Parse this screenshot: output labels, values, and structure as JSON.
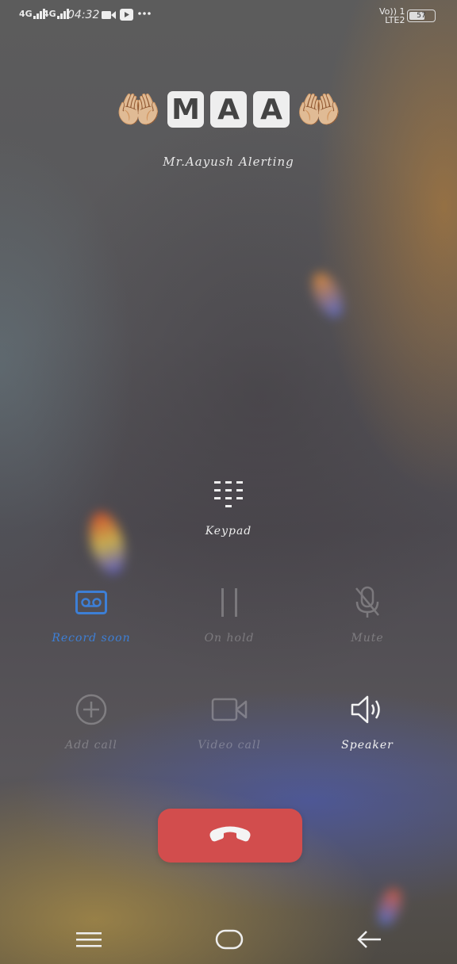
{
  "status_bar": {
    "sim1_network": "4G",
    "sim2_network": "4G",
    "time": "04:32",
    "notification_icons": [
      "video-camera-icon",
      "youtube-icon",
      "more-dots-icon"
    ],
    "volte_label": "Vo)) 1",
    "lte_label": "LTE2",
    "battery_percent": "57"
  },
  "contact": {
    "name_letters": [
      "M",
      "A",
      "A"
    ],
    "emoji": "🤲🏼",
    "subtitle": "Mr.Aayush  Alerting"
  },
  "keypad": {
    "label": "Keypad"
  },
  "controls": [
    {
      "id": "record",
      "label": "Record soon",
      "icon": "record-tape-icon",
      "state": "active",
      "color": "#3d7fd6"
    },
    {
      "id": "hold",
      "label": "On hold",
      "icon": "pause-icon",
      "state": "disabled"
    },
    {
      "id": "mute",
      "label": "Mute",
      "icon": "microphone-off-icon",
      "state": "disabled"
    },
    {
      "id": "add_call",
      "label": "Add call",
      "icon": "plus-circle-icon",
      "state": "disabled"
    },
    {
      "id": "video_call",
      "label": "Video call",
      "icon": "video-camera-icon",
      "state": "disabled"
    },
    {
      "id": "speaker",
      "label": "Speaker",
      "icon": "speaker-icon",
      "state": "enabled"
    }
  ],
  "end_call": {
    "icon": "end-call-icon",
    "color": "#d24d4d"
  },
  "nav_bar": {
    "icons": [
      "menu-icon",
      "home-icon",
      "back-icon"
    ]
  }
}
